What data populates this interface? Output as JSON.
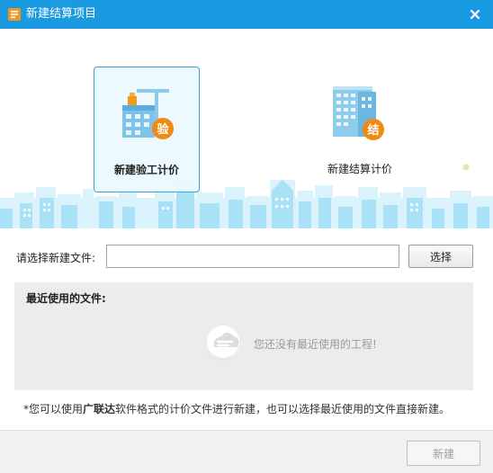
{
  "window": {
    "title": "新建结算项目",
    "close_icon": "close-icon",
    "accent": "#1a9ae0"
  },
  "options": [
    {
      "label": "新建验工计价",
      "badge": "验",
      "selected": true,
      "icon": "construction-building-icon"
    },
    {
      "label": "新建结算计价",
      "badge": "结",
      "selected": false,
      "icon": "office-building-icon"
    }
  ],
  "file": {
    "label": "请选择新建文件:",
    "value": "",
    "select_label": "选择"
  },
  "recent": {
    "title": "最近使用的文件:",
    "empty_text": "您还没有最近使用的工程!",
    "empty_icon": "empty-cloud-icon"
  },
  "hint": {
    "prefix": "*您可以使用",
    "brand": "广联达",
    "suffix": "软件格式的计价文件进行新建，也可以选择最近使用的文件直接新建。"
  },
  "footer": {
    "create_label": "新建",
    "create_enabled": false
  }
}
